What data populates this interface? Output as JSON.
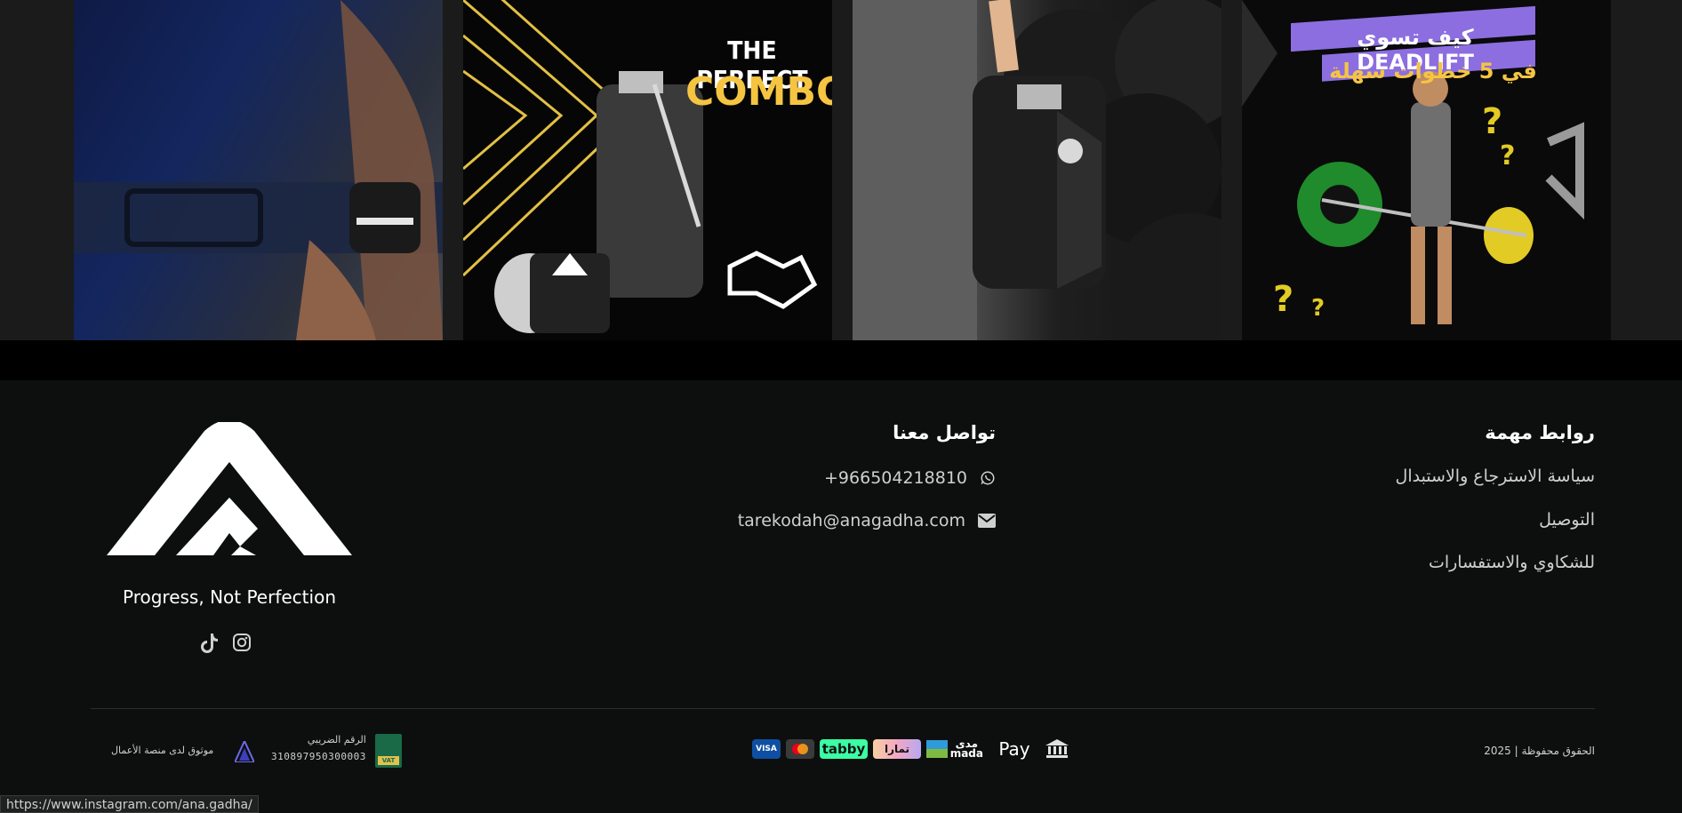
{
  "banners": {
    "combo_line1": "THE PERFECT",
    "combo_line2": "COMBO",
    "deadlift_line1": "كيف تسوي DEADLIFT",
    "deadlift_line2": "في 5 خطوات سهلة"
  },
  "footer": {
    "links_title": "روابط مهمة",
    "links": [
      "سياسة الاسترجاع والاستبدال",
      "التوصيل",
      "للشكاوي والاستفسارات"
    ],
    "contact_title": "تواصل معنا",
    "phone": "+966504218810",
    "email": "tarekodah@anagadha.com",
    "tagline": "Progress, Not Perfection",
    "copyright": "الحقوق محفوظة | 2025",
    "payment_methods": [
      "bank",
      "Apple Pay",
      "mada",
      "tamara",
      "tabby",
      "mastercard",
      "VISA"
    ],
    "tax_label": "الرقم الضريبي",
    "tax_number": "310897950300003",
    "verified_text": "موثوق لدى منصة الأعمال",
    "vat_badge": "VAT"
  },
  "status_bar": {
    "url": "https://www.instagram.com/ana.gadha/"
  },
  "colors": {
    "background": "#0d0f0f",
    "combo_yellow": "#f5c542",
    "tabby_green": "#3bffa3"
  }
}
